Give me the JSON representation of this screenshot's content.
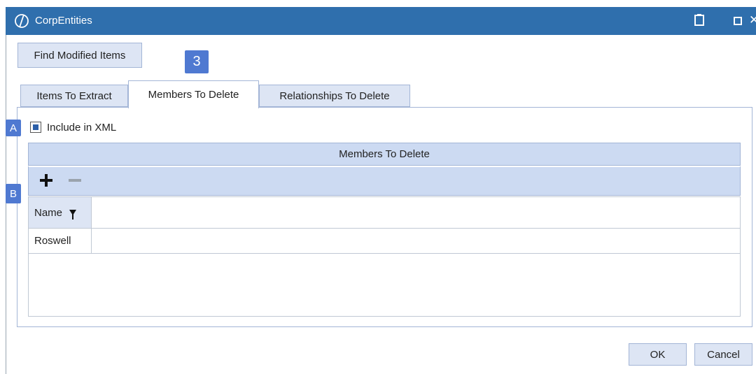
{
  "window": {
    "title": "CorpEntities",
    "icons": [
      "app-logo-icon",
      "clipboard-icon",
      "maximize-icon",
      "close-icon"
    ]
  },
  "toolbar": {
    "find_label": "Find Modified Items"
  },
  "callouts": {
    "three": "3",
    "a": "A",
    "b": "B"
  },
  "tabs": [
    {
      "label": "Items To Extract",
      "active": false
    },
    {
      "label": "Members To Delete",
      "active": true
    },
    {
      "label": "Relationships To Delete",
      "active": false
    }
  ],
  "include": {
    "label": "Include in XML",
    "checked": true
  },
  "grid": {
    "title": "Members To Delete",
    "columns": [
      "Name"
    ],
    "rows": [
      {
        "name": "Roswell"
      }
    ]
  },
  "footer": {
    "ok_label": "OK",
    "cancel_label": "Cancel"
  },
  "colors": {
    "titlebar": "#2f6fad",
    "callout": "#4f79d1",
    "grid_header": "#ccdaf2",
    "button": "#dde5f4"
  }
}
